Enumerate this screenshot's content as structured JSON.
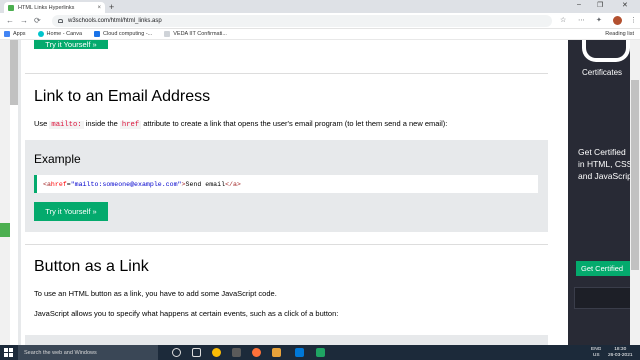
{
  "browser": {
    "tab_title": "HTML Links Hyperlinks",
    "tab_close": "×",
    "new_tab": "+",
    "url": "w3schools.com/html/html_links.asp",
    "window_controls": {
      "minimize": "–",
      "maximize": "❐",
      "close": "✕"
    },
    "nav": {
      "back": "←",
      "forward": "→",
      "reload": "⟳"
    },
    "toolbar_icons": {
      "star": "☆",
      "extensions": "⋯",
      "menu": "⋮"
    },
    "bookmarks": [
      {
        "label": "Apps",
        "color": "#4285f4"
      },
      {
        "label": "Home - Canva",
        "color": "#00c4cc"
      },
      {
        "label": "Cloud computing -...",
        "color": "#1a73e8"
      },
      {
        "label": "VEDA IIT Confirmati...",
        "color": "#e8eaed"
      }
    ],
    "reading_list": "Reading list"
  },
  "page": {
    "top_button": "Try it Yourself »",
    "section1": {
      "heading": "Link to an Email Address",
      "text_before": "Use ",
      "code1": "mailto:",
      "text_mid": " inside the ",
      "code2": "href",
      "text_after": " attribute to create a link that opens the user's email program (to let them send a new email):"
    },
    "example": {
      "title": "Example",
      "code": {
        "open": "<a ",
        "attr": "href",
        "eq": "=",
        "val": "\"mailto:someone@example.com\"",
        "close_open": ">",
        "text": "Send email",
        "end_tag": "</a>"
      },
      "button": "Try it Yourself »"
    },
    "section2": {
      "heading": "Button as a Link",
      "p1": "To use an HTML button as a link, you have to add some JavaScript code.",
      "p2": "JavaScript allows you to specify what happens at certain events, such as a click of a button:"
    }
  },
  "ad": {
    "certificates": "Certificates",
    "line1": "Get Certified",
    "line2": "in HTML, CSS",
    "line3": "and JavaScript",
    "button": "Get Certified"
  },
  "taskbar": {
    "search_placeholder": "Search the web and Windows",
    "lang": "ENG",
    "region": "US",
    "time": "18:30",
    "date": "26-03-2021"
  },
  "colors": {
    "w3_green": "#04aa6d",
    "example_bg": "#e7e9eb",
    "ad_bg": "#282a35",
    "taskbar_bg": "#1c2a3a",
    "code_keyword": "#dc143c"
  }
}
